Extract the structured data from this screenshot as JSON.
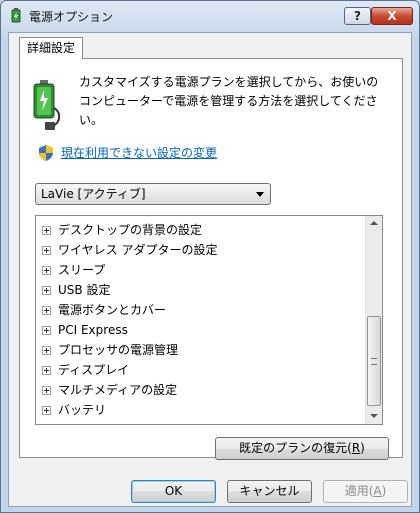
{
  "window": {
    "title": "電源オプション",
    "help_label": "?",
    "close_label": "X"
  },
  "tab": {
    "label": "詳細設定"
  },
  "description": "カスタマイズする電源プランを選択してから、お使いのコンピューターで電源を管理する方法を選択してください。",
  "change_settings_link": "現在利用できない設定の変更",
  "plan_select": {
    "selected": "LaVie [アクティブ]"
  },
  "tree_items": [
    {
      "label": "デスクトップの背景の設定"
    },
    {
      "label": "ワイヤレス アダプターの設定"
    },
    {
      "label": "スリープ"
    },
    {
      "label": "USB 設定"
    },
    {
      "label": "電源ボタンとカバー"
    },
    {
      "label": "PCI Express"
    },
    {
      "label": "プロセッサの電源管理"
    },
    {
      "label": "ディスプレイ"
    },
    {
      "label": "マルチメディアの設定"
    },
    {
      "label": "バッテリ"
    }
  ],
  "buttons": {
    "restore_text": "既定のプランの復元(",
    "restore_key": "R",
    "restore_end": ")",
    "ok": "OK",
    "cancel": "キャンセル",
    "apply_text": "適用(",
    "apply_key": "A",
    "apply_end": ")"
  },
  "colors": {
    "highlight": "#e0201c",
    "link": "#0066cc",
    "titlebar": "#c4d5e9"
  },
  "icons": {
    "title": "power-options-icon",
    "battery": "battery-plug-icon",
    "shield": "uac-shield-icon"
  }
}
